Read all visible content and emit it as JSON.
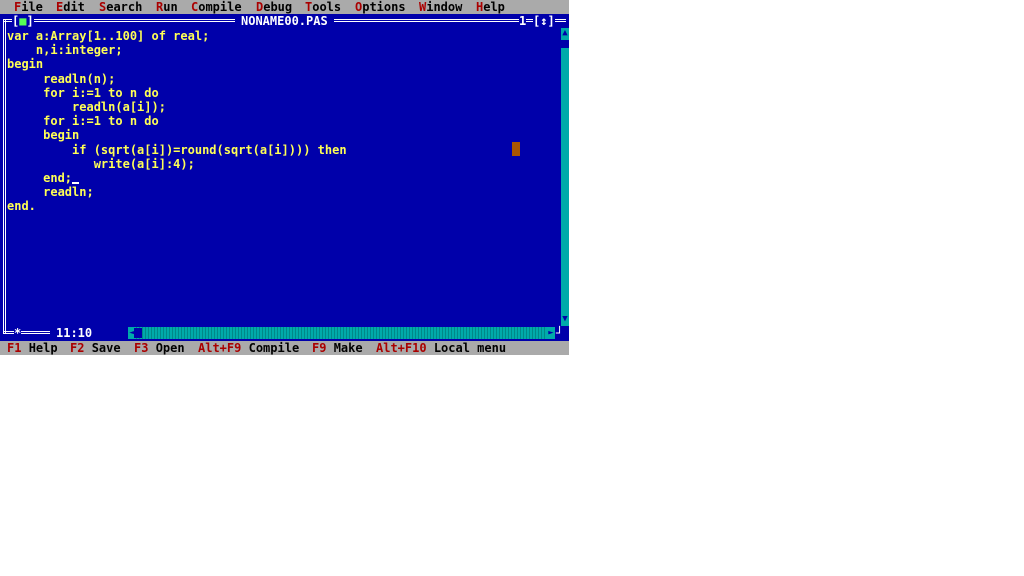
{
  "menu": [
    {
      "hot": "F",
      "rest": "ile"
    },
    {
      "hot": "E",
      "rest": "dit"
    },
    {
      "hot": "S",
      "rest": "earch"
    },
    {
      "hot": "R",
      "rest": "un"
    },
    {
      "hot": "C",
      "rest": "ompile"
    },
    {
      "hot": "D",
      "rest": "ebug"
    },
    {
      "hot": "T",
      "rest": "ools"
    },
    {
      "hot": "O",
      "rest": "ptions"
    },
    {
      "hot": "W",
      "rest": "indow"
    },
    {
      "hot": "H",
      "rest": "elp"
    }
  ],
  "window": {
    "title": "NONAME00.PAS",
    "close_left": "[",
    "close_glyph": "■",
    "close_right": "]",
    "number": "1",
    "zoom": "[↕]",
    "cursor_pos": "11:10",
    "modified_star": "*"
  },
  "code": {
    "lines": [
      "var a:Array[1..100] of real;",
      "    n,i:integer;",
      "begin",
      "     readln(n);",
      "     for i:=1 to n do",
      "         readln(a[i]);",
      "     for i:=1 to n do",
      "     begin",
      "         if (sqrt(a[i])=round(sqrt(a[i]))) then",
      "            write(a[i]:4);",
      "     end;",
      "     readln;",
      "end."
    ]
  },
  "status": [
    {
      "key": "F1",
      "label": "Help"
    },
    {
      "key": "F2",
      "label": "Save"
    },
    {
      "key": "F3",
      "label": "Open"
    },
    {
      "key": "Alt+F9",
      "label": "Compile"
    },
    {
      "key": "F9",
      "label": "Make"
    },
    {
      "key": "Alt+F10",
      "label": "Local menu"
    }
  ],
  "colors": {
    "editor_bg": "#0000aa",
    "code_text": "#ffff55",
    "menu_bg": "#aaaaaa",
    "hotkey": "#aa0000",
    "scrollbar": "#00aaaa"
  },
  "icons": {
    "scroll_up": "▲",
    "scroll_down": "▼",
    "scroll_left": "◄",
    "scroll_right": "►"
  }
}
